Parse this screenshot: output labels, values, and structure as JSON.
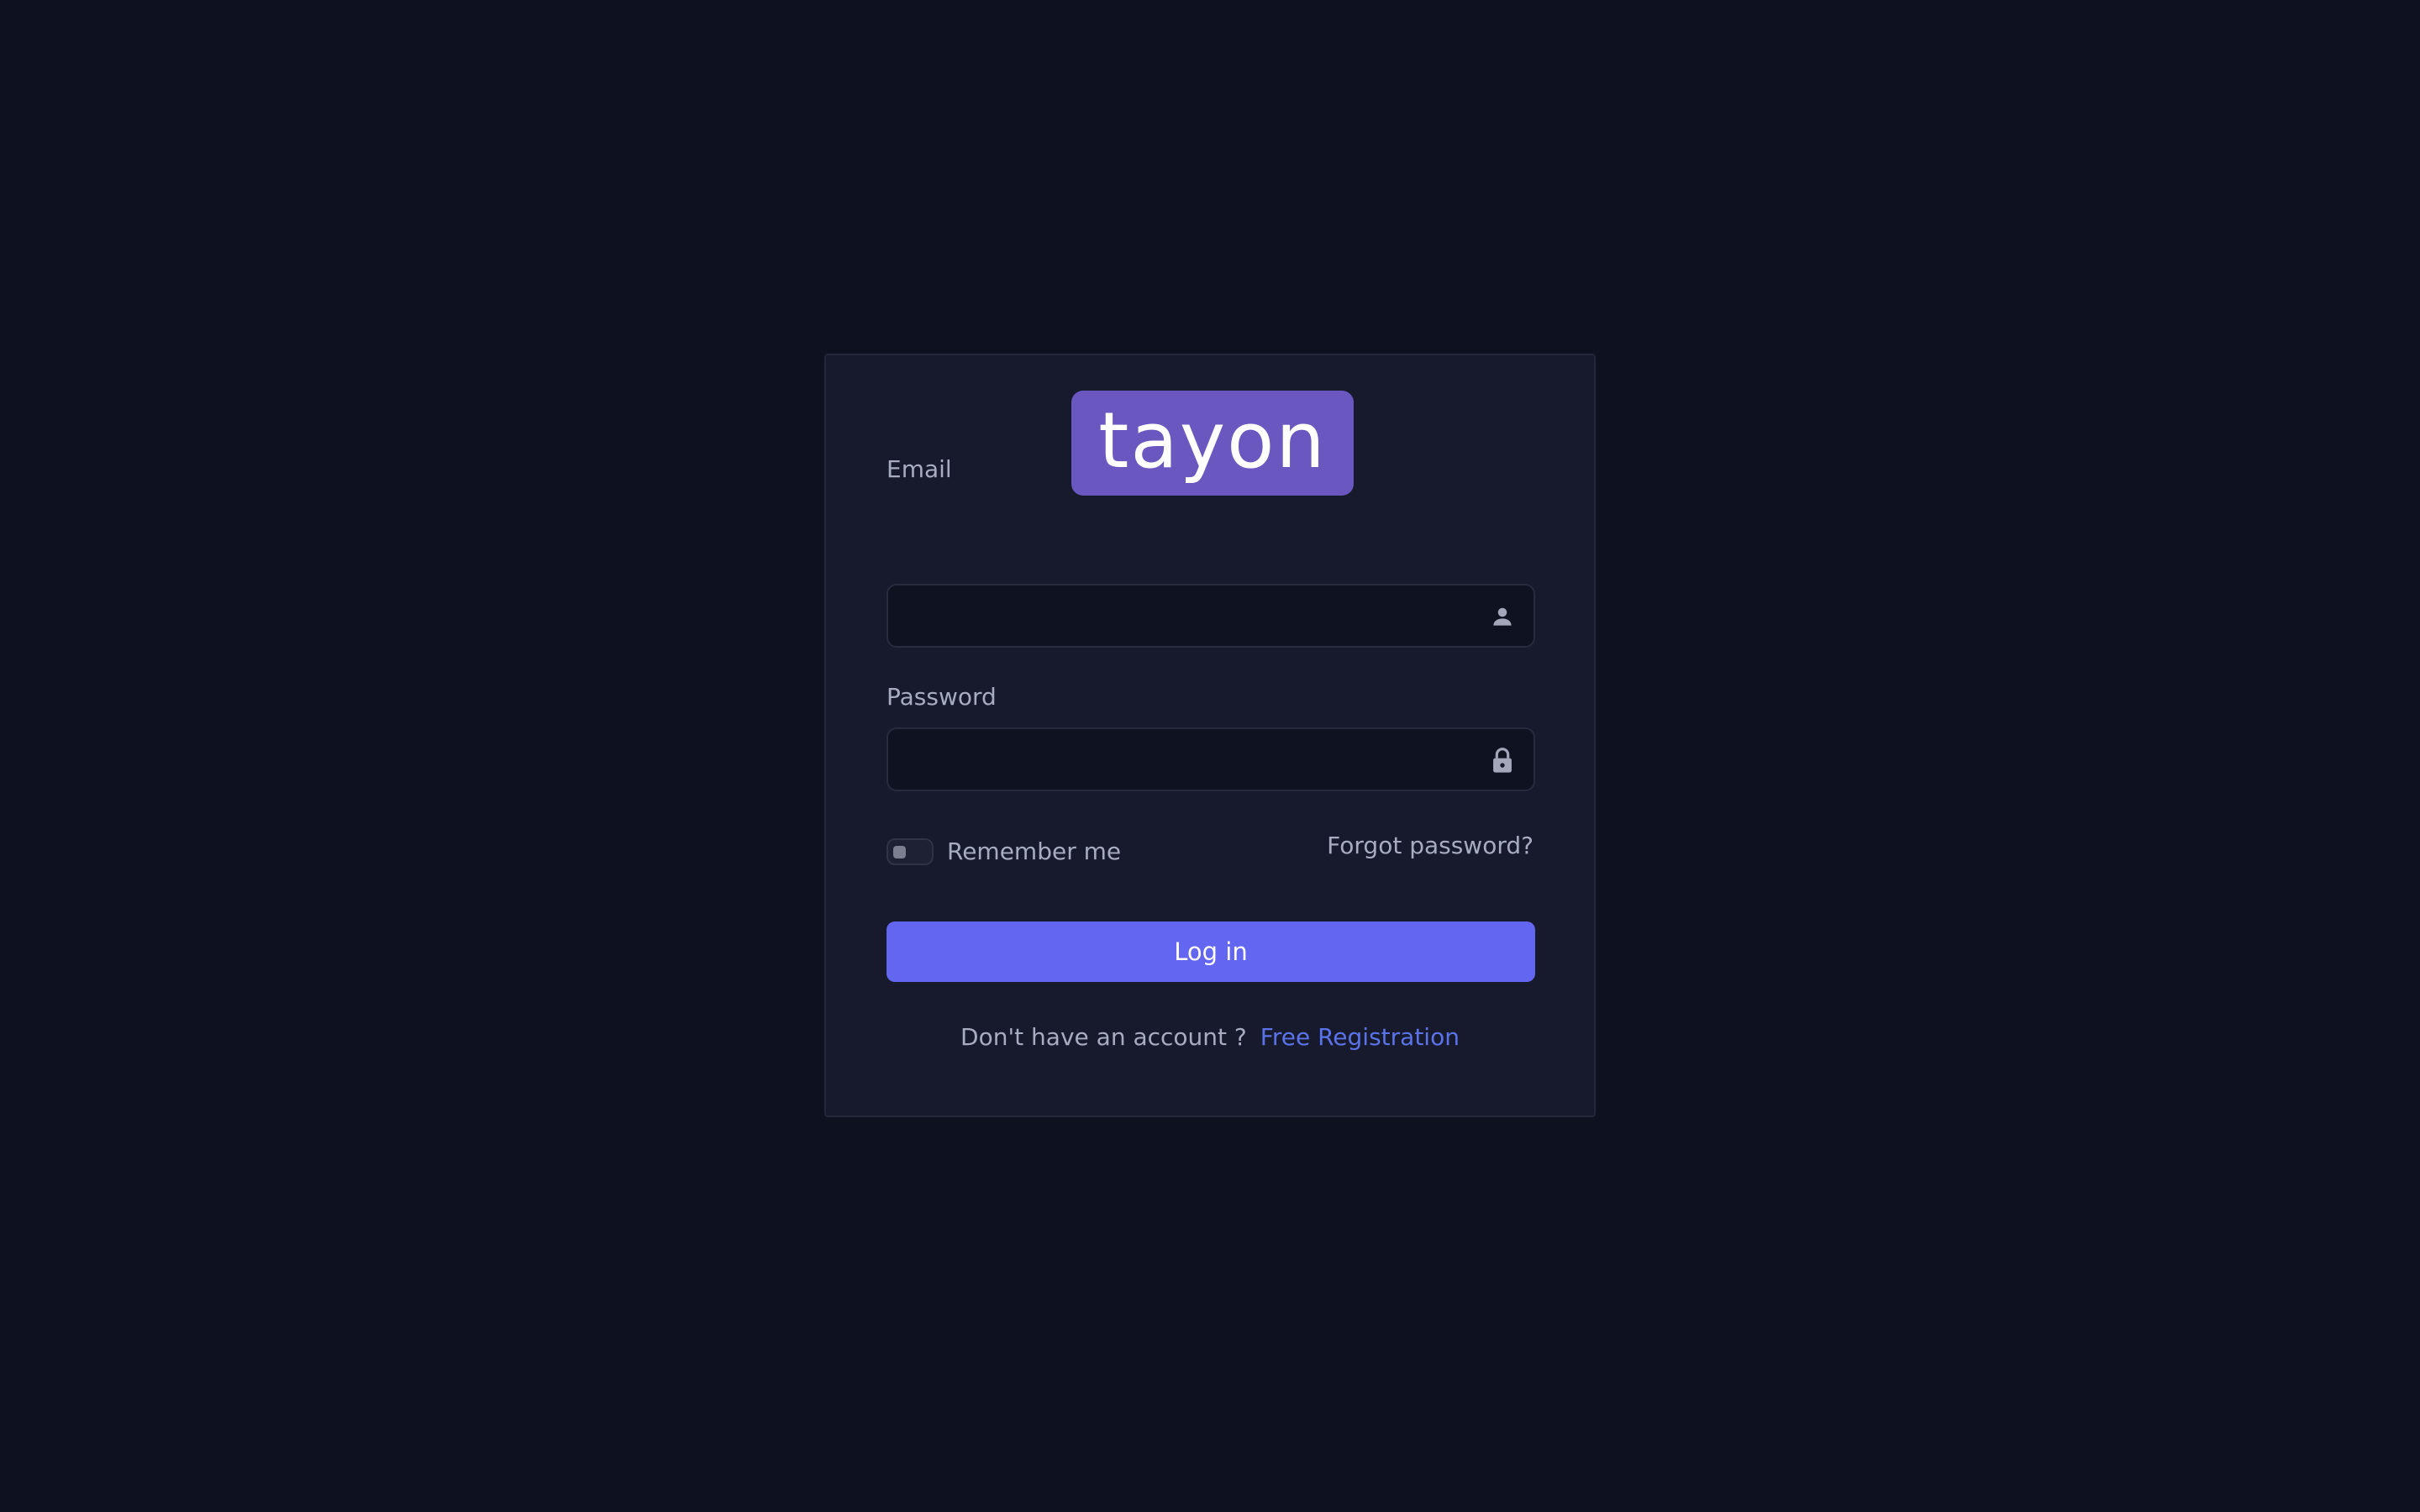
{
  "logo": {
    "text": "tayon",
    "bg_color": "#6b57c0"
  },
  "form": {
    "email": {
      "label": "Email",
      "value": "",
      "placeholder": "",
      "icon": "user-icon"
    },
    "password": {
      "label": "Password",
      "value": "",
      "placeholder": "",
      "icon": "lock-icon"
    },
    "remember": {
      "label": "Remember me",
      "checked": false
    },
    "forgot_label": "Forgot password?",
    "submit_label": "Log in"
  },
  "footer": {
    "text": "Don't have an account ?",
    "link_label": "Free Registration"
  },
  "colors": {
    "background": "#0e1120",
    "card": "#171a2c",
    "accent": "#6366f1",
    "link": "#5b73e8",
    "muted_text": "#a8acc0"
  }
}
